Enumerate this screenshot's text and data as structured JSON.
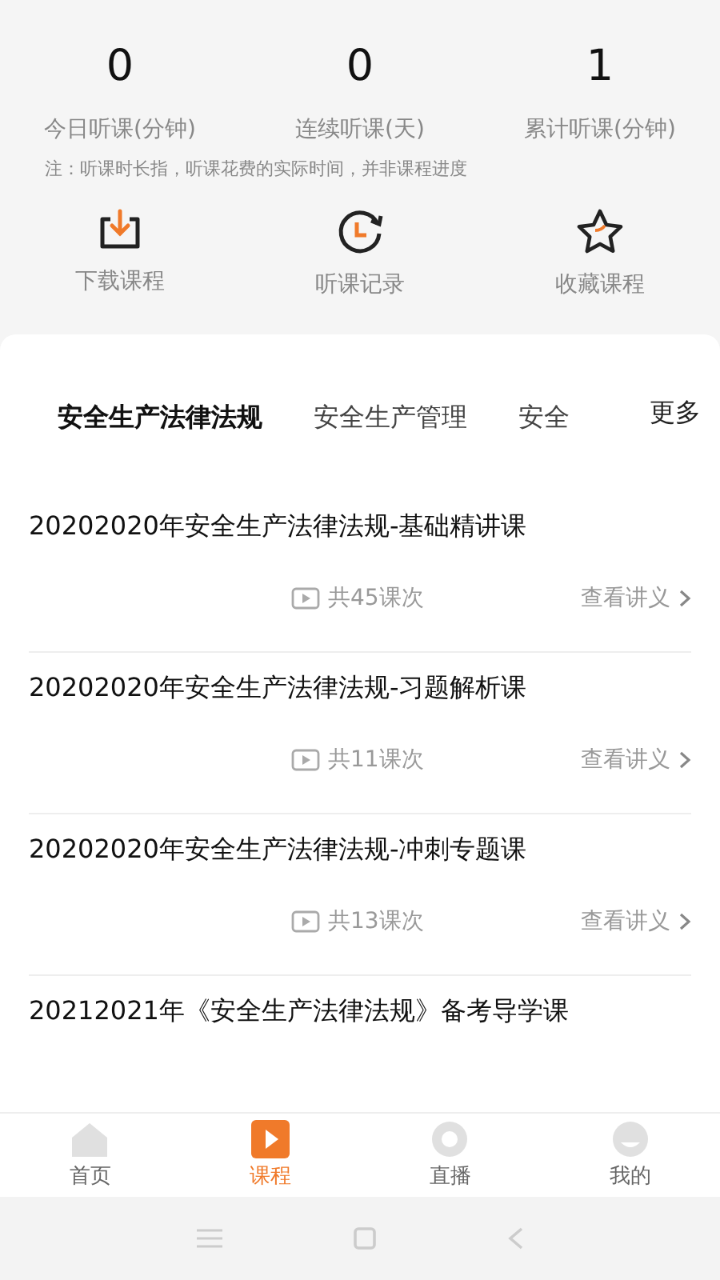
{
  "stats": [
    {
      "value": "0",
      "label": "今日听课(分钟)"
    },
    {
      "value": "0",
      "label": "连续听课(天)"
    },
    {
      "value": "1",
      "label": "累计听课(分钟)"
    }
  ],
  "note": "注：听课时长指，听课花费的实际时间，并非课程进度",
  "shortcuts": [
    {
      "kind": "download",
      "label": "下载课程"
    },
    {
      "kind": "history",
      "label": "听课记录"
    },
    {
      "kind": "favorite",
      "label": "收藏课程"
    }
  ],
  "tabs": [
    {
      "label": "安全生产法律法规",
      "selected": true
    },
    {
      "label": "安全生产管理",
      "selected": false
    },
    {
      "label": "安全",
      "selected": false
    }
  ],
  "more": "更多",
  "courses": [
    {
      "title": "20202020年安全生产法律法规-基础精讲课",
      "lessons": "共45课次",
      "handout": "查看讲义"
    },
    {
      "title": "20202020年安全生产法律法规-习题解析课",
      "lessons": "共11课次",
      "handout": "查看讲义"
    },
    {
      "title": "20202020年安全生产法律法规-冲刺专题课",
      "lessons": "共13课次",
      "handout": "查看讲义"
    },
    {
      "title": "20212021年《安全生产法律法规》备考导学课"
    }
  ],
  "bottom_nav": [
    {
      "kind": "home",
      "label": "首页",
      "selected": false
    },
    {
      "kind": "course",
      "label": "课程",
      "selected": true
    },
    {
      "kind": "live",
      "label": "直播",
      "selected": false
    },
    {
      "kind": "me",
      "label": "我的",
      "selected": false
    }
  ]
}
